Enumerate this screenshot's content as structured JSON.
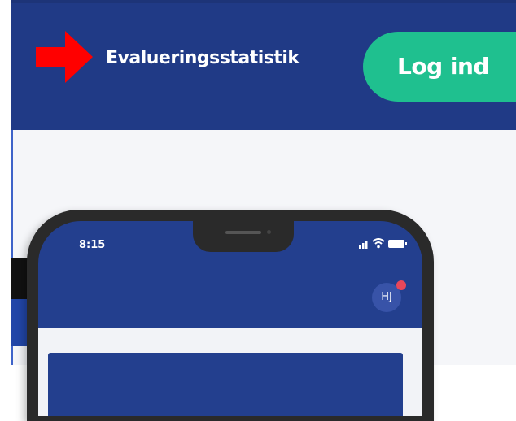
{
  "header": {
    "nav_link": "Evalueringsstatistik",
    "login_button": "Log ind",
    "background_color": "#203a86",
    "login_color": "#1fc08f",
    "annotation": {
      "icon": "arrow-right-icon",
      "color": "#ff0000"
    }
  },
  "phone": {
    "status_time": "8:15",
    "status_icons": [
      "signal-icon",
      "wifi-icon",
      "battery-icon"
    ],
    "avatar_initials": "HJ",
    "notification_color": "#e8475a"
  }
}
